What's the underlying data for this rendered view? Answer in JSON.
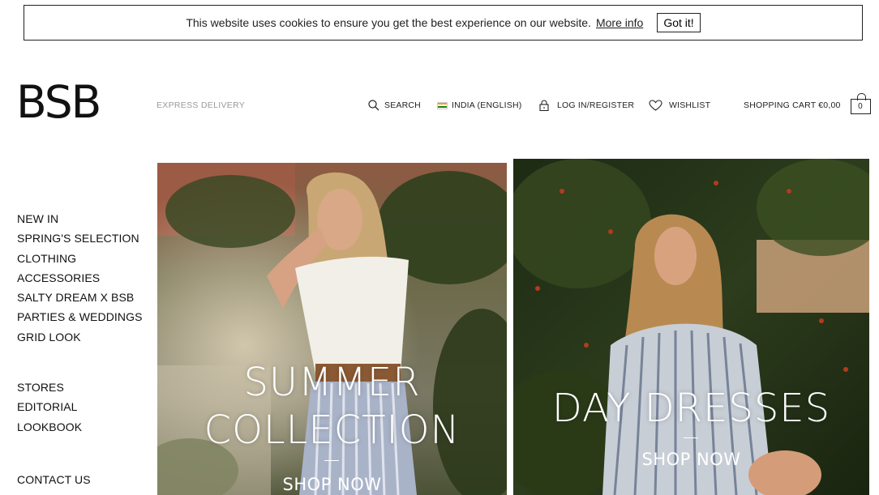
{
  "cookie": {
    "message": "This website uses cookies to ensure you get the best experience on our website.",
    "more_info": "More info",
    "got_it": "Got it!"
  },
  "header": {
    "logo": "BSB",
    "express_delivery": "EXPRESS DELIVERY",
    "search": "SEARCH",
    "country": "INDIA (ENGLISH)",
    "login": "LOG IN/REGISTER",
    "wishlist": "WISHLIST",
    "cart_label": "SHOPPING CART €0,00",
    "cart_count": "0"
  },
  "sidebar": {
    "main": [
      "NEW IN",
      "SPRING'S SELECTION",
      "CLOTHING",
      "ACCESSORIES",
      "SALTY DREAM X BSB",
      "PARTIES & WEDDINGS",
      "GRID LOOK"
    ],
    "secondary": [
      "STORES",
      "EDITORIAL",
      "LOOKBOOK"
    ],
    "contact": "CONTACT US"
  },
  "heroes": {
    "left": {
      "title_line1": "SUMMER",
      "title_line2": "COLLECTION",
      "cta": "SHOP NOW"
    },
    "right": {
      "title": "DAY DRESSES",
      "cta": "SHOP NOW"
    }
  },
  "colors": {
    "flag_saffron": "#ff9933",
    "flag_white": "#ffffff",
    "flag_green": "#138808"
  }
}
